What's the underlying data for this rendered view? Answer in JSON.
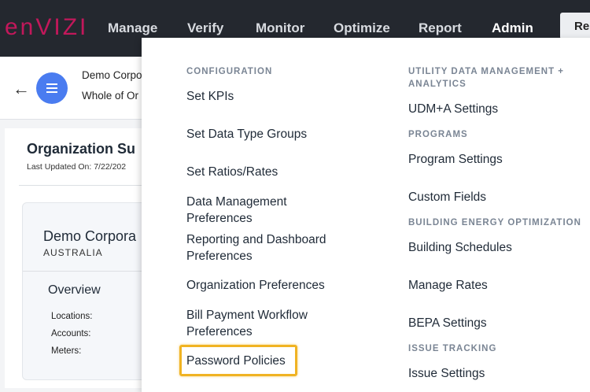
{
  "brand": {
    "logo_text": "enVIZI",
    "logo_color": "#c2185b"
  },
  "nav": {
    "items": [
      "Manage",
      "Verify",
      "Monitor",
      "Optimize",
      "Report",
      "Admin"
    ],
    "active": "Admin",
    "report_button": "Rep"
  },
  "subheader": {
    "crumb1": "Demo Corpo",
    "crumb2": "Whole of Or"
  },
  "summary": {
    "title": "Organization Su",
    "last_updated": "Last Updated On: 7/22/202",
    "org_name": "Demo Corpora",
    "country": "AUSTRALIA",
    "overview_label": "Overview",
    "stats": [
      "Locations:",
      "Accounts:",
      "Meters:"
    ]
  },
  "admin_menu": {
    "configuration_header": "CONFIGURATION",
    "configuration_items": [
      "Set KPIs",
      "Set Data Type Groups",
      "Set Ratios/Rates",
      "Data Management Preferences",
      "Reporting and Dashboard Preferences",
      "Organization Preferences",
      "Bill Payment Workflow Preferences",
      "Password Policies"
    ],
    "udm_header": "UTILITY DATA MANAGEMENT + ANALYTICS",
    "udm_item": "UDM+A Settings",
    "programs_header": "PROGRAMS",
    "programs_items": [
      "Program Settings",
      "Custom Fields"
    ],
    "beo_header": "BUILDING ENERGY OPTIMIZATION",
    "beo_items": [
      "Building Schedules",
      "Manage Rates",
      "BEPA Settings"
    ],
    "issue_header": "ISSUE TRACKING",
    "issue_item": "Issue Settings",
    "highlighted": "Password Policies",
    "highlight_color": "#f0b323"
  }
}
